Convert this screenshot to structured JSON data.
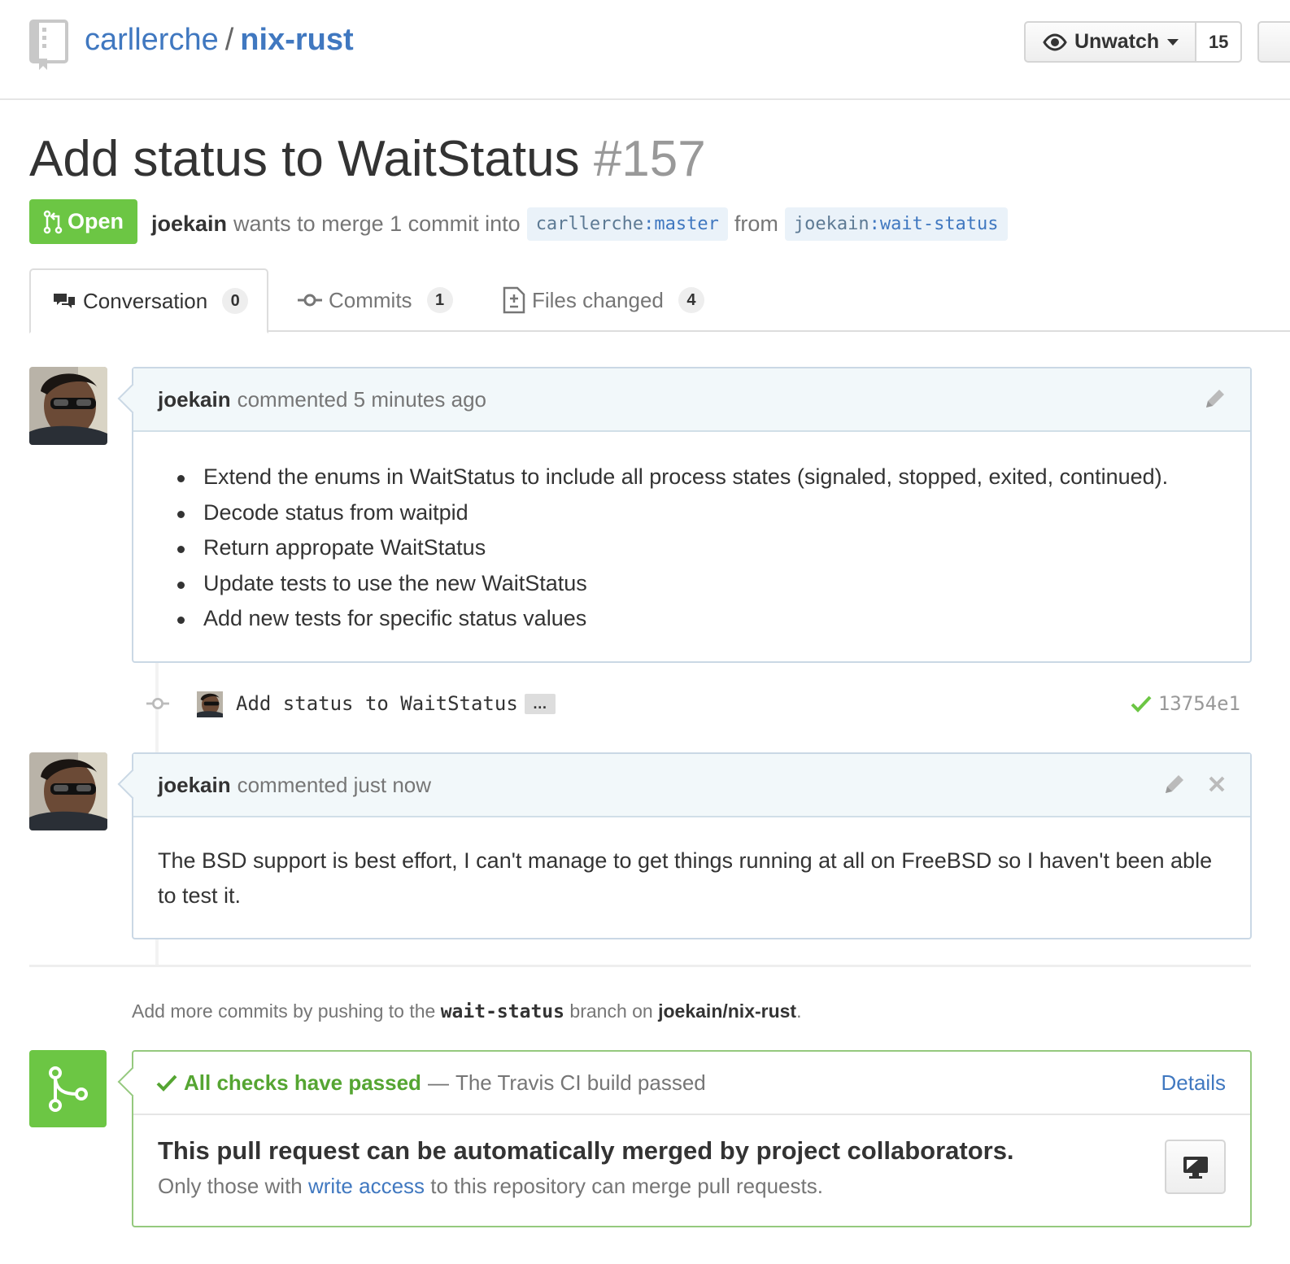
{
  "repo": {
    "owner": "carllerche",
    "separator": "/",
    "name": "nix-rust",
    "icon": "repo-icon"
  },
  "watch": {
    "label": "Unwatch",
    "count": "15",
    "icon": "eye-icon"
  },
  "pull_request": {
    "title": "Add status to WaitStatus",
    "number": "#157",
    "state": "Open",
    "author": "joekain",
    "merge_text": "wants to merge 1 commit into",
    "base_user": "carllerche",
    "base_branch": "master",
    "from_text": "from",
    "head_user": "joekain",
    "head_branch": "wait-status",
    "branch_sep": ":"
  },
  "tabs": [
    {
      "label": "Conversation",
      "count": "0",
      "icon": "comment-discussion-icon"
    },
    {
      "label": "Commits",
      "count": "1",
      "icon": "git-commit-icon"
    },
    {
      "label": "Files changed",
      "count": "4",
      "icon": "diff-icon"
    }
  ],
  "comments": [
    {
      "author": "joekain",
      "action": "commented 5 minutes ago",
      "items": [
        "Extend the enums in WaitStatus to include all process states (signaled, stopped, exited, continued).",
        "Decode status from waitpid",
        "Return appropate WaitStatus",
        "Update tests to use the new WaitStatus",
        "Add new tests for specific status values"
      ]
    },
    {
      "author": "joekain",
      "action": "commented just now",
      "body": "The BSD support is best effort, I can't manage to get things running at all on FreeBSD so I haven't been able to test it."
    }
  ],
  "commit": {
    "message": "Add status to WaitStatus",
    "ellipsis": "…",
    "sha": "13754e1"
  },
  "push_hint": {
    "prefix": "Add more commits by pushing to the",
    "branch": "wait-status",
    "middle": "branch on",
    "repo": "joekain/nix-rust",
    "suffix": "."
  },
  "merge": {
    "checks_status": "All checks have passed",
    "dash": "—",
    "checks_detail": "The Travis CI build passed",
    "details_label": "Details",
    "heading": "This pull request can be automatically merged by project collaborators.",
    "note_prefix": "Only those with",
    "note_link": "write access",
    "note_suffix": "to this repository can merge pull requests."
  },
  "colors": {
    "open_green": "#6cc644",
    "link_blue": "#4078c0",
    "check_green": "#55a532"
  }
}
